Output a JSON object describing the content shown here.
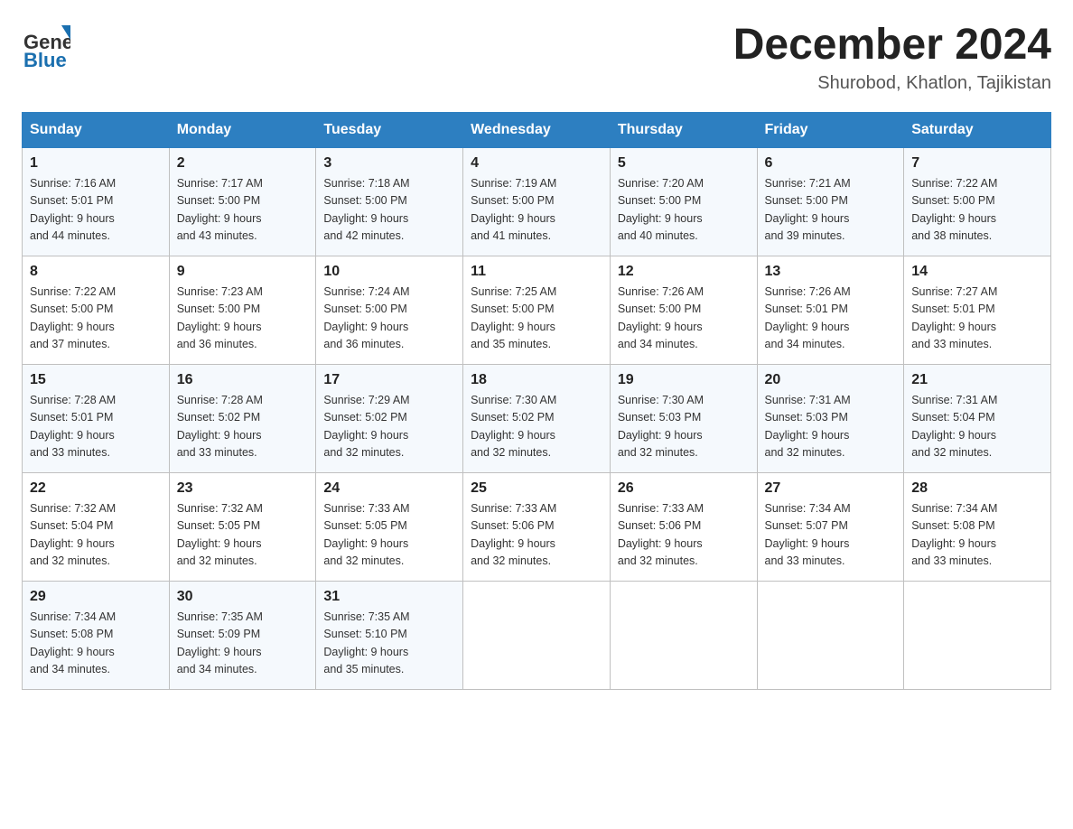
{
  "logo": {
    "text_general": "General",
    "text_blue": "Blue"
  },
  "title": "December 2024",
  "subtitle": "Shurobod, Khatlon, Tajikistan",
  "days_of_week": [
    "Sunday",
    "Monday",
    "Tuesday",
    "Wednesday",
    "Thursday",
    "Friday",
    "Saturday"
  ],
  "weeks": [
    [
      {
        "day": "1",
        "sunrise": "7:16 AM",
        "sunset": "5:01 PM",
        "daylight": "9 hours and 44 minutes."
      },
      {
        "day": "2",
        "sunrise": "7:17 AM",
        "sunset": "5:00 PM",
        "daylight": "9 hours and 43 minutes."
      },
      {
        "day": "3",
        "sunrise": "7:18 AM",
        "sunset": "5:00 PM",
        "daylight": "9 hours and 42 minutes."
      },
      {
        "day": "4",
        "sunrise": "7:19 AM",
        "sunset": "5:00 PM",
        "daylight": "9 hours and 41 minutes."
      },
      {
        "day": "5",
        "sunrise": "7:20 AM",
        "sunset": "5:00 PM",
        "daylight": "9 hours and 40 minutes."
      },
      {
        "day": "6",
        "sunrise": "7:21 AM",
        "sunset": "5:00 PM",
        "daylight": "9 hours and 39 minutes."
      },
      {
        "day": "7",
        "sunrise": "7:22 AM",
        "sunset": "5:00 PM",
        "daylight": "9 hours and 38 minutes."
      }
    ],
    [
      {
        "day": "8",
        "sunrise": "7:22 AM",
        "sunset": "5:00 PM",
        "daylight": "9 hours and 37 minutes."
      },
      {
        "day": "9",
        "sunrise": "7:23 AM",
        "sunset": "5:00 PM",
        "daylight": "9 hours and 36 minutes."
      },
      {
        "day": "10",
        "sunrise": "7:24 AM",
        "sunset": "5:00 PM",
        "daylight": "9 hours and 36 minutes."
      },
      {
        "day": "11",
        "sunrise": "7:25 AM",
        "sunset": "5:00 PM",
        "daylight": "9 hours and 35 minutes."
      },
      {
        "day": "12",
        "sunrise": "7:26 AM",
        "sunset": "5:00 PM",
        "daylight": "9 hours and 34 minutes."
      },
      {
        "day": "13",
        "sunrise": "7:26 AM",
        "sunset": "5:01 PM",
        "daylight": "9 hours and 34 minutes."
      },
      {
        "day": "14",
        "sunrise": "7:27 AM",
        "sunset": "5:01 PM",
        "daylight": "9 hours and 33 minutes."
      }
    ],
    [
      {
        "day": "15",
        "sunrise": "7:28 AM",
        "sunset": "5:01 PM",
        "daylight": "9 hours and 33 minutes."
      },
      {
        "day": "16",
        "sunrise": "7:28 AM",
        "sunset": "5:02 PM",
        "daylight": "9 hours and 33 minutes."
      },
      {
        "day": "17",
        "sunrise": "7:29 AM",
        "sunset": "5:02 PM",
        "daylight": "9 hours and 32 minutes."
      },
      {
        "day": "18",
        "sunrise": "7:30 AM",
        "sunset": "5:02 PM",
        "daylight": "9 hours and 32 minutes."
      },
      {
        "day": "19",
        "sunrise": "7:30 AM",
        "sunset": "5:03 PM",
        "daylight": "9 hours and 32 minutes."
      },
      {
        "day": "20",
        "sunrise": "7:31 AM",
        "sunset": "5:03 PM",
        "daylight": "9 hours and 32 minutes."
      },
      {
        "day": "21",
        "sunrise": "7:31 AM",
        "sunset": "5:04 PM",
        "daylight": "9 hours and 32 minutes."
      }
    ],
    [
      {
        "day": "22",
        "sunrise": "7:32 AM",
        "sunset": "5:04 PM",
        "daylight": "9 hours and 32 minutes."
      },
      {
        "day": "23",
        "sunrise": "7:32 AM",
        "sunset": "5:05 PM",
        "daylight": "9 hours and 32 minutes."
      },
      {
        "day": "24",
        "sunrise": "7:33 AM",
        "sunset": "5:05 PM",
        "daylight": "9 hours and 32 minutes."
      },
      {
        "day": "25",
        "sunrise": "7:33 AM",
        "sunset": "5:06 PM",
        "daylight": "9 hours and 32 minutes."
      },
      {
        "day": "26",
        "sunrise": "7:33 AM",
        "sunset": "5:06 PM",
        "daylight": "9 hours and 32 minutes."
      },
      {
        "day": "27",
        "sunrise": "7:34 AM",
        "sunset": "5:07 PM",
        "daylight": "9 hours and 33 minutes."
      },
      {
        "day": "28",
        "sunrise": "7:34 AM",
        "sunset": "5:08 PM",
        "daylight": "9 hours and 33 minutes."
      }
    ],
    [
      {
        "day": "29",
        "sunrise": "7:34 AM",
        "sunset": "5:08 PM",
        "daylight": "9 hours and 34 minutes."
      },
      {
        "day": "30",
        "sunrise": "7:35 AM",
        "sunset": "5:09 PM",
        "daylight": "9 hours and 34 minutes."
      },
      {
        "day": "31",
        "sunrise": "7:35 AM",
        "sunset": "5:10 PM",
        "daylight": "9 hours and 35 minutes."
      },
      null,
      null,
      null,
      null
    ]
  ],
  "labels": {
    "sunrise": "Sunrise:",
    "sunset": "Sunset:",
    "daylight": "Daylight:"
  }
}
